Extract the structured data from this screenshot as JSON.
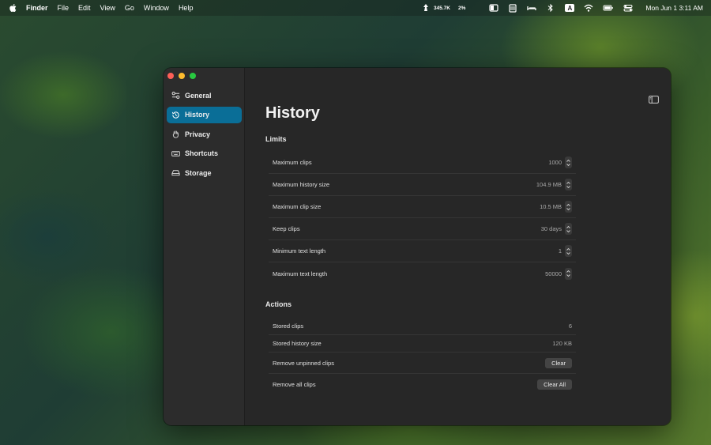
{
  "menubar": {
    "app": "Finder",
    "items": [
      "File",
      "Edit",
      "View",
      "Go",
      "Window",
      "Help"
    ],
    "network": "345.7K",
    "cpu": "2%",
    "input_source": "A",
    "clock": "Mon Jun 1  3:11 AM"
  },
  "sidebar": {
    "items": [
      {
        "label": "General",
        "icon": "sliders-icon"
      },
      {
        "label": "History",
        "icon": "clock-history-icon"
      },
      {
        "label": "Privacy",
        "icon": "hand-icon"
      },
      {
        "label": "Shortcuts",
        "icon": "keyboard-icon"
      },
      {
        "label": "Storage",
        "icon": "drive-icon"
      }
    ],
    "active": "History"
  },
  "main": {
    "title": "History",
    "limits": {
      "title": "Limits",
      "rows": [
        {
          "label": "Maximum clips",
          "value": "1000"
        },
        {
          "label": "Maximum history size",
          "value": "104.9 MB"
        },
        {
          "label": "Maximum clip size",
          "value": "10.5 MB"
        },
        {
          "label": "Keep clips",
          "value": "30 days"
        },
        {
          "label": "Minimum text length",
          "value": "1"
        },
        {
          "label": "Maximum text length",
          "value": "50000"
        }
      ]
    },
    "actions": {
      "title": "Actions",
      "stored_clips_label": "Stored clips",
      "stored_clips_value": "6",
      "stored_size_label": "Stored history size",
      "stored_size_value": "120 KB",
      "remove_unpinned_label": "Remove unpinned clips",
      "clear_button": "Clear",
      "remove_all_label": "Remove all clips",
      "clear_all_button": "Clear All"
    }
  },
  "colors": {
    "accent": "#0a6e97",
    "window_bg": "#272727",
    "sidebar_bg": "#2c2c2c"
  }
}
